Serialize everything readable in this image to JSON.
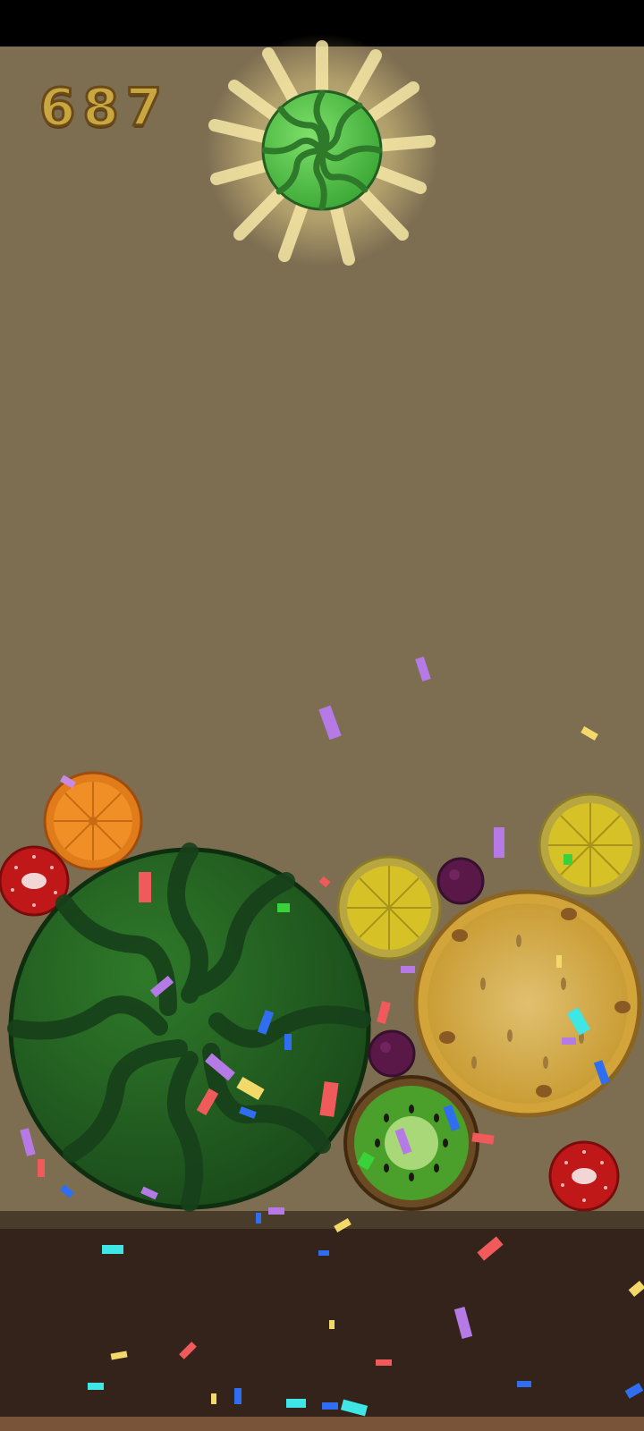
{
  "game": {
    "score": "687",
    "next_fruit": "watermelon"
  },
  "fruits_in_container": [
    "orange",
    "strawberry",
    "watermelon",
    "lemon",
    "grape",
    "lemon",
    "pineapple",
    "grape",
    "kiwi",
    "strawberry"
  ],
  "icons": {
    "drop_preview": "watermelon-icon",
    "glow": "sunburst-glow-icon"
  },
  "colors": {
    "background": "#7d6e52",
    "ground": "#33231a",
    "score_fill": "#c8a640",
    "score_outline": "#6a4a18"
  }
}
